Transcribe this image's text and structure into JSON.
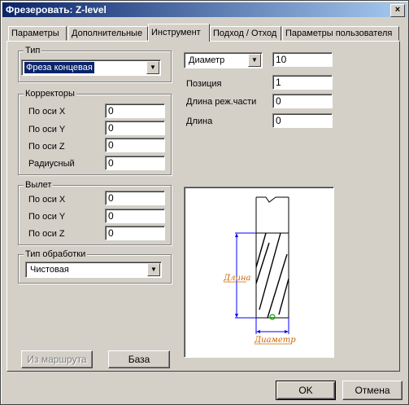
{
  "window": {
    "title": "Фрезеровать: Z-level",
    "close": "×"
  },
  "tabs": [
    {
      "label": "Параметры"
    },
    {
      "label": "Дополнительные"
    },
    {
      "label": "Инструмент"
    },
    {
      "label": "Подход / Отход"
    },
    {
      "label": "Параметры пользователя"
    }
  ],
  "type_group": {
    "title": "Тип",
    "value": "Фреза концевая"
  },
  "correctors": {
    "title": "Корректоры",
    "rows": [
      {
        "label": "По оси X",
        "value": "0"
      },
      {
        "label": "По оси Y",
        "value": "0"
      },
      {
        "label": "По оси Z",
        "value": "0"
      },
      {
        "label": "Радиусный",
        "value": "0"
      }
    ]
  },
  "overhang": {
    "title": "Вылет",
    "rows": [
      {
        "label": "По оси X",
        "value": "0"
      },
      {
        "label": "По оси Y",
        "value": "0"
      },
      {
        "label": "По оси Z",
        "value": "0"
      }
    ]
  },
  "processing": {
    "title": "Тип обработки",
    "value": "Чистовая"
  },
  "params": {
    "dimension_select": "Диаметр",
    "dimension_value": "10",
    "position_label": "Позиция",
    "position_value": "1",
    "cut_length_label": "Длина реж.части",
    "cut_length_value": "0",
    "length_label": "Длина",
    "length_value": "0"
  },
  "preview": {
    "length_caption": "Длина",
    "diameter_caption": "Диаметр"
  },
  "buttons": {
    "from_route": "Из маршрута",
    "base": "База",
    "ok": "OK",
    "cancel": "Отмена"
  }
}
